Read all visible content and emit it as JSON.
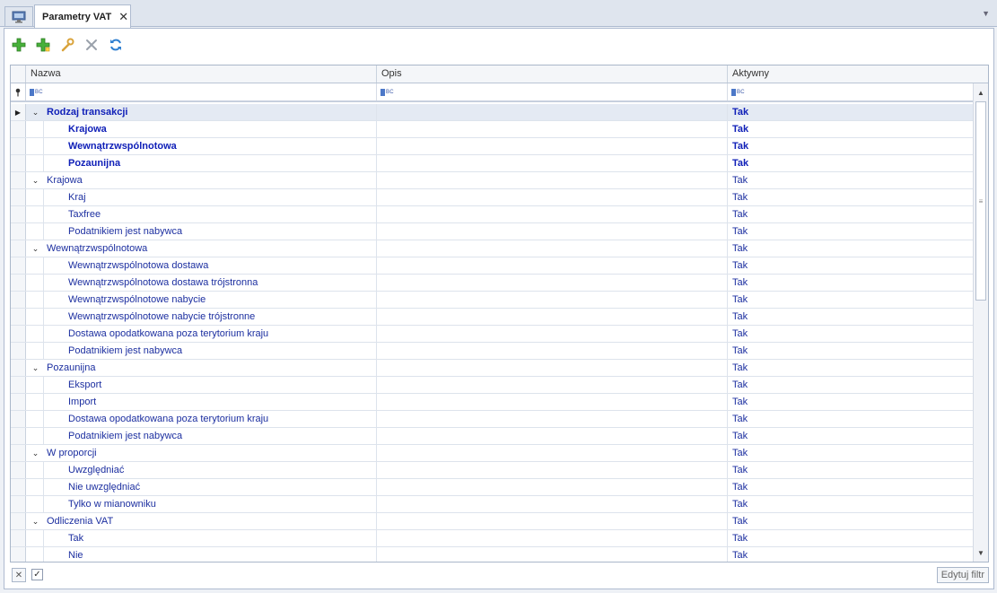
{
  "tabs": {
    "active_label": "Parametry VAT",
    "close_glyph": "✕",
    "menu_glyph": "▼"
  },
  "toolbar": {
    "icons": [
      "add-icon",
      "add-subitem-icon",
      "edit-icon",
      "delete-icon",
      "refresh-icon"
    ]
  },
  "columns": {
    "name": "Nazwa",
    "desc": "Opis",
    "active": "Aktywny"
  },
  "filter": {
    "abc": "BC"
  },
  "rows": [
    {
      "name": "Rodzaj transakcji",
      "active": "Tak",
      "level": 0,
      "bold": true,
      "selected": true
    },
    {
      "name": "Krajowa",
      "active": "Tak",
      "level": 1,
      "bold": true
    },
    {
      "name": "Wewnątrzwspólnotowa",
      "active": "Tak",
      "level": 1,
      "bold": true
    },
    {
      "name": "Pozaunijna",
      "active": "Tak",
      "level": 1,
      "bold": true
    },
    {
      "name": "Krajowa",
      "active": "Tak",
      "level": 0
    },
    {
      "name": "Kraj",
      "active": "Tak",
      "level": 1
    },
    {
      "name": "Taxfree",
      "active": "Tak",
      "level": 1
    },
    {
      "name": "Podatnikiem jest nabywca",
      "active": "Tak",
      "level": 1
    },
    {
      "name": "Wewnątrzwspólnotowa",
      "active": "Tak",
      "level": 0
    },
    {
      "name": "Wewnątrzwspólnotowa dostawa",
      "active": "Tak",
      "level": 1
    },
    {
      "name": "Wewnątrzwspólnotowa dostawa trójstronna",
      "active": "Tak",
      "level": 1
    },
    {
      "name": "Wewnątrzwspólnotowe nabycie",
      "active": "Tak",
      "level": 1
    },
    {
      "name": "Wewnątrzwspólnotowe nabycie trójstronne",
      "active": "Tak",
      "level": 1
    },
    {
      "name": "Dostawa opodatkowana poza terytorium kraju",
      "active": "Tak",
      "level": 1
    },
    {
      "name": "Podatnikiem jest nabywca",
      "active": "Tak",
      "level": 1
    },
    {
      "name": "Pozaunijna",
      "active": "Tak",
      "level": 0
    },
    {
      "name": "Eksport",
      "active": "Tak",
      "level": 1
    },
    {
      "name": "Import",
      "active": "Tak",
      "level": 1
    },
    {
      "name": "Dostawa opodatkowana poza terytorium kraju",
      "active": "Tak",
      "level": 1
    },
    {
      "name": "Podatnikiem jest nabywca",
      "active": "Tak",
      "level": 1
    },
    {
      "name": "W proporcji",
      "active": "Tak",
      "level": 0
    },
    {
      "name": "Uwzględniać",
      "active": "Tak",
      "level": 1
    },
    {
      "name": "Nie uwzględniać",
      "active": "Tak",
      "level": 1
    },
    {
      "name": "Tylko w mianowniku",
      "active": "Tak",
      "level": 1
    },
    {
      "name": "Odliczenia VAT",
      "active": "Tak",
      "level": 0
    },
    {
      "name": "Tak",
      "active": "Tak",
      "level": 1
    },
    {
      "name": "Nie",
      "active": "Tak",
      "level": 1
    }
  ],
  "footer": {
    "edit_filter": "Edytuj filtr",
    "clear_glyph": "✕",
    "check_glyph": "✓"
  },
  "colors": {
    "accent_text": "#1c2fa0",
    "bold_text": "#1020b8",
    "selected_row": "#e4eaf3",
    "add_icon": "#3aa02c"
  }
}
